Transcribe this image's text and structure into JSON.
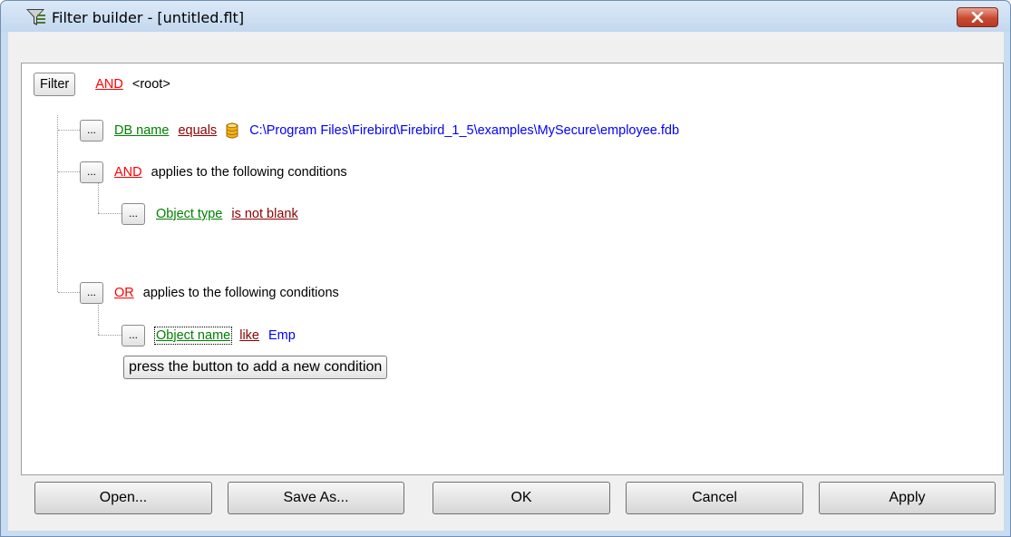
{
  "window": {
    "title": "Filter builder - [untitled.flt]",
    "close_icon": "close-x-icon",
    "app_icon": "filter-builder-icon"
  },
  "tree": {
    "root": {
      "button": "Filter",
      "operator": "AND",
      "label": "<root>"
    },
    "conditions": [
      {
        "button": "...",
        "field": "DB name",
        "operator": "equals",
        "value_icon": "database-icon",
        "value": "C:\\Program Files\\Firebird\\Firebird_1_5\\examples\\MySecure\\employee.fdb"
      },
      {
        "button": "...",
        "operator": "AND",
        "text": "applies to the following conditions"
      },
      {
        "button": "...",
        "field": "Object type",
        "operator": "is not blank"
      },
      {
        "button": "...",
        "operator": "OR",
        "text": "applies to the following conditions"
      },
      {
        "button": "...",
        "field": "Object name",
        "operator": "like",
        "value": "Emp"
      }
    ],
    "add_condition": "press the button to add a new condition"
  },
  "footer": {
    "open": "Open...",
    "save_as": "Save As...",
    "ok": "OK",
    "cancel": "Cancel",
    "apply": "Apply"
  },
  "colors": {
    "operator": "#ff0000",
    "field": "#008000",
    "condition": "#8b0000",
    "value": "#0000ff",
    "close_button": "#c84a30"
  }
}
